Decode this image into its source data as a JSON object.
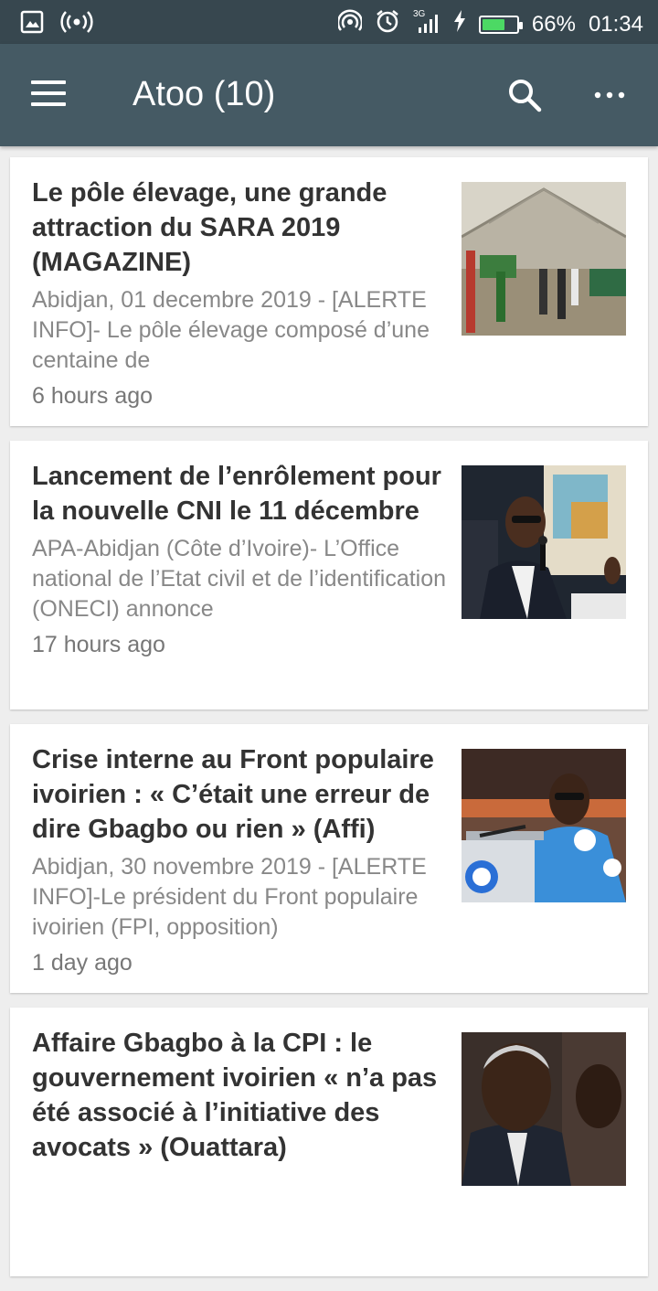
{
  "status_bar": {
    "battery_percent": "66%",
    "battery_level": 0.66,
    "time": "01:34",
    "network": "3G",
    "colors": {
      "bar": "#37474f",
      "battery": "#4cd964"
    }
  },
  "app_bar": {
    "title": "Atoo (10)",
    "color": "#455a64"
  },
  "articles": [
    {
      "title": "Le pôle élevage, une grande attraction du SARA 2019 (MAGAZINE)",
      "excerpt": "Abidjan, 01 decembre 2019 - [ALERTE INFO]- Le pôle élevage composé d’une centaine de",
      "time": "6 hours ago",
      "image": "exhibition-tent-photo"
    },
    {
      "title": "Lancement de l’enrôlement pour la nouvelle CNI le 11 décembre",
      "excerpt": "APA-Abidjan (Côte d’Ivoire)- L’Office national de l’Etat civil et de l’identification (ONECI) annonce",
      "time": "17 hours ago",
      "image": "speaker-with-microphone-photo"
    },
    {
      "title": "Crise interne au Front populaire ivoirien : « C’était une erreur de dire Gbagbo ou rien » (Affi)",
      "excerpt": "Abidjan, 30 novembre 2019 - [ALERTE INFO]-Le président du Front populaire ivoirien (FPI, opposition)",
      "time": "1 day ago",
      "image": "politician-at-podium-photo"
    },
    {
      "title": "Affaire Gbagbo à la CPI : le gouvernement ivoirien « n’a pas été associé à l’initiative des avocats » (Ouattara)",
      "excerpt": "",
      "time": "",
      "image": "portrait-photo"
    }
  ]
}
